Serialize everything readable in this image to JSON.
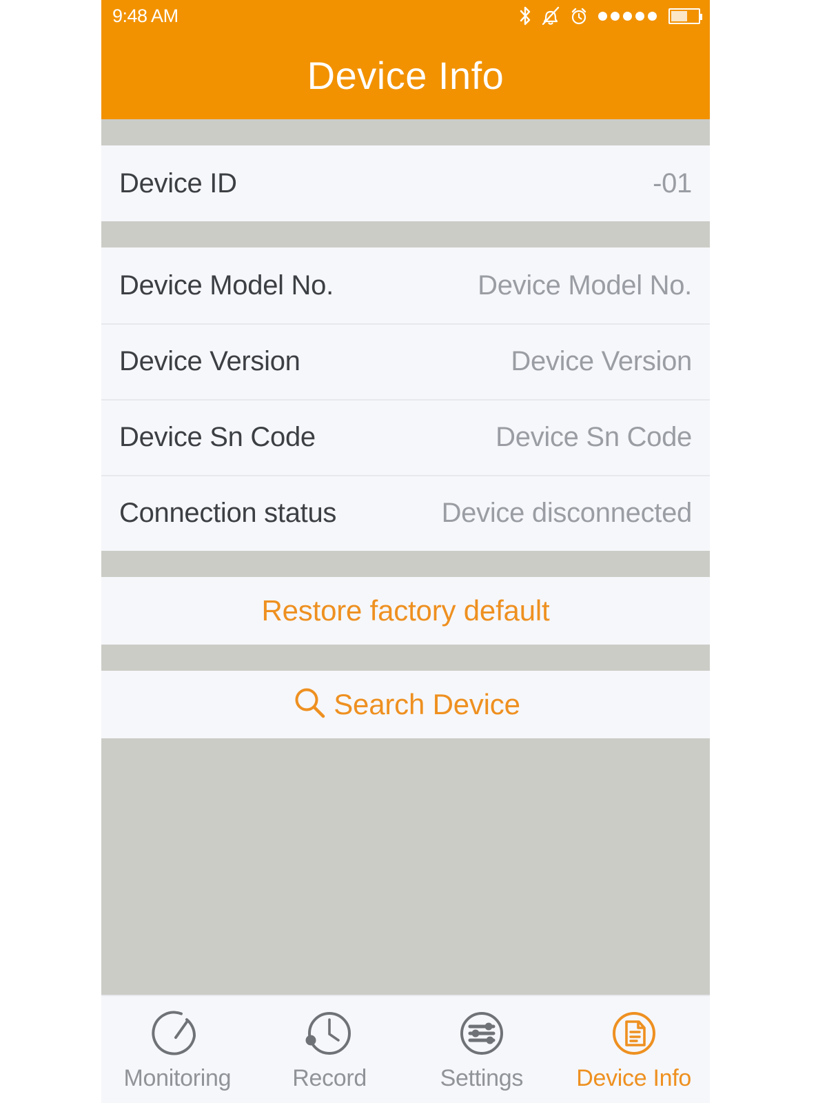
{
  "status_bar": {
    "time": "9:48 AM",
    "icons": [
      "bluetooth-icon",
      "bell-muted-icon",
      "alarm-clock-icon",
      "signal-dots",
      "battery-icon"
    ],
    "battery_percent": 55,
    "signal_dots": 5
  },
  "header": {
    "title": "Device Info",
    "background_color": "#F29200",
    "text_color": "#FFFFFF"
  },
  "info_groups": [
    {
      "rows": [
        {
          "label": "Device ID",
          "value": "-01"
        }
      ]
    },
    {
      "rows": [
        {
          "label": "Device Model No.",
          "value": "Device Model No."
        },
        {
          "label": "Device Version",
          "value": "Device Version"
        },
        {
          "label": "Device Sn Code",
          "value": "Device Sn Code"
        },
        {
          "label": "Connection status",
          "value": "Device disconnected"
        }
      ]
    }
  ],
  "actions": {
    "restore_label": "Restore factory default",
    "search_label": "Search Device",
    "search_icon": "magnifier-icon",
    "accent_color": "#EE9020"
  },
  "tab_bar": {
    "active_index": 3,
    "tabs": [
      {
        "label": "Monitoring",
        "icon": "gauge-icon"
      },
      {
        "label": "Record",
        "icon": "clock-icon"
      },
      {
        "label": "Settings",
        "icon": "sliders-icon"
      },
      {
        "label": "Device Info",
        "icon": "document-icon"
      }
    ]
  },
  "colors": {
    "accent": "#F29200",
    "card_bg": "#F6F7FA",
    "page_bg": "#CCCCC7",
    "label_text": "#3C3F43",
    "value_text": "#9A9DA3",
    "tab_inactive": "#909398"
  }
}
